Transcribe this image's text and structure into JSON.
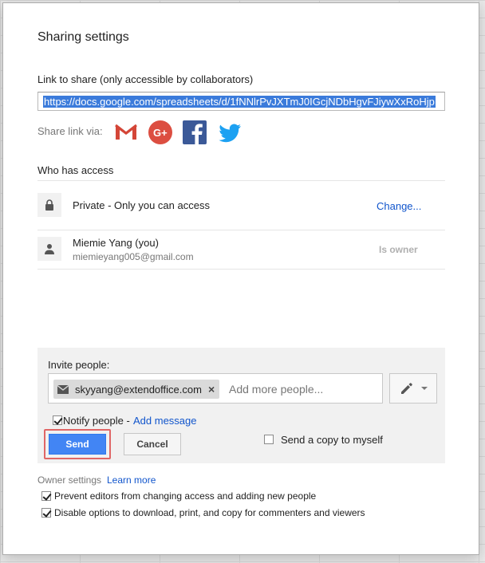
{
  "dialog": {
    "title": "Sharing settings",
    "link_label": "Link to share (only accessible by collaborators)",
    "link_url": "https://docs.google.com/spreadsheets/d/1fNNlrPvJXTmJ0IGcjNDbHgvFJiywXxRoHjp",
    "share_via_label": "Share link via:",
    "share_icons": [
      "gmail-icon",
      "google-plus-icon",
      "facebook-icon",
      "twitter-icon"
    ],
    "who_has_access_label": "Who has access"
  },
  "access": {
    "private_text": "Private - Only you can access",
    "change_link": "Change...",
    "owner_name": "Miemie Yang (you)",
    "owner_email": "miemieyang005@gmail.com",
    "owner_role": "Is owner"
  },
  "invite": {
    "label": "Invite people:",
    "chip_email": "skyyang@extendoffice.com",
    "placeholder": "Add more people...",
    "notify_label": "Notify people -",
    "notify_checked": true,
    "add_message": "Add message",
    "send_label": "Send",
    "cancel_label": "Cancel",
    "copy_label": "Send a copy to myself",
    "copy_checked": false
  },
  "owner_settings": {
    "label": "Owner settings",
    "learn_more": "Learn more",
    "options": [
      {
        "label": "Prevent editors from changing access and adding new people",
        "checked": true
      },
      {
        "label": "Disable options to download, print, and copy for commenters and viewers",
        "checked": true
      }
    ]
  },
  "colors": {
    "link_blue": "#1155cc",
    "send_blue": "#4285f4",
    "highlight_red": "#e06666",
    "selection_blue": "#3b7bdb"
  }
}
